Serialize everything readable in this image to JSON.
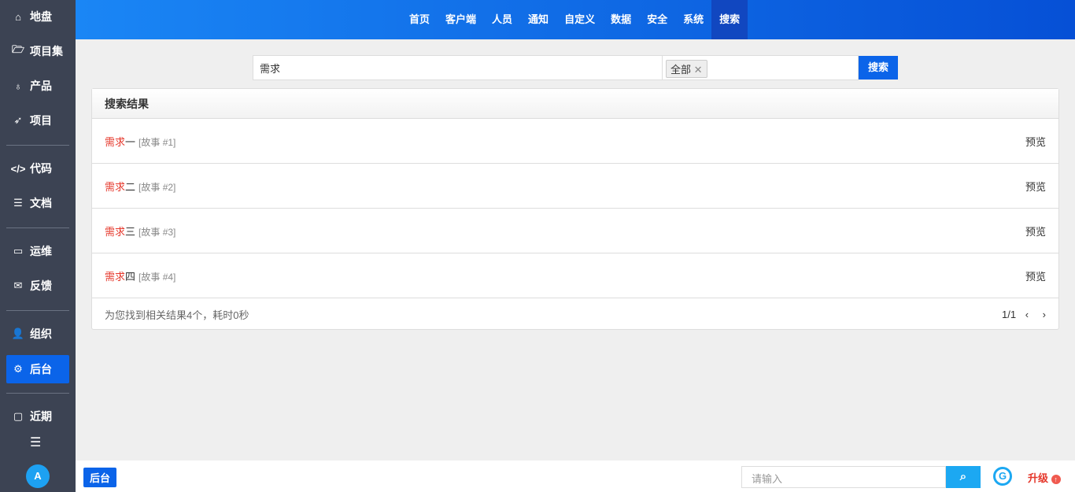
{
  "sidebar": {
    "items": [
      {
        "label": "地盘",
        "icon": "home-icon"
      },
      {
        "label": "项目集",
        "icon": "folder-icon"
      },
      {
        "label": "产品",
        "icon": "lightbulb-icon"
      },
      {
        "label": "项目",
        "icon": "rocket-icon"
      },
      {
        "label": "代码",
        "icon": "code-icon"
      },
      {
        "label": "文档",
        "icon": "doc-icon"
      },
      {
        "label": "运维",
        "icon": "ops-icon"
      },
      {
        "label": "反馈",
        "icon": "feedback-icon"
      },
      {
        "label": "组织",
        "icon": "users-icon"
      },
      {
        "label": "后台",
        "icon": "gear-icon"
      },
      {
        "label": "近期",
        "icon": "recent-icon"
      }
    ],
    "avatar": "A"
  },
  "nav": [
    "首页",
    "客户端",
    "人员",
    "通知",
    "自定义",
    "数据",
    "安全",
    "系统",
    "搜索"
  ],
  "search": {
    "query": "需求",
    "filter_tag": "全部",
    "button": "搜索"
  },
  "results": {
    "title": "搜索结果",
    "items": [
      {
        "hl": "需求",
        "rest": "一",
        "tag": "[故事 #1]",
        "action": "预览"
      },
      {
        "hl": "需求",
        "rest": "二",
        "tag": "[故事 #2]",
        "action": "预览"
      },
      {
        "hl": "需求",
        "rest": "三",
        "tag": "[故事 #3]",
        "action": "预览"
      },
      {
        "hl": "需求",
        "rest": "四",
        "tag": "[故事 #4]",
        "action": "预览"
      }
    ],
    "summary": "为您找到相关结果4个，耗时0秒",
    "page": "1/1"
  },
  "bottom": {
    "tab": "后台",
    "placeholder": "请输入",
    "upgrade": "升级"
  },
  "colors": {
    "accent": "#0b64e9",
    "highlight": "#e5372b"
  }
}
